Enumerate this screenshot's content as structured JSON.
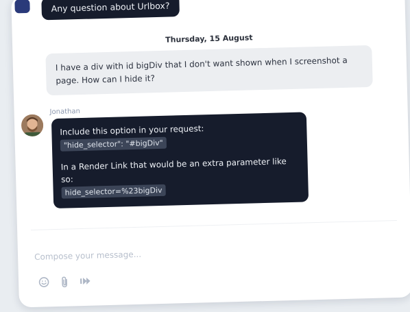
{
  "previous_message": {
    "text": "Any question about Urlbox?"
  },
  "date_separator": "Thursday, 15 August",
  "incoming_message": {
    "text": "I have a div with id bigDiv that I don't want shown when I screenshot a page. How can I hide it?"
  },
  "reply": {
    "sender_name": "Jonathan",
    "line1": "Include this option in your request:",
    "code1": "\"hide_selector\": \"#bigDiv\"",
    "line2": "In a Render Link that would be an extra parameter like so:",
    "code2": "hide_selector=%23bigDiv"
  },
  "composer": {
    "placeholder": "Compose your message..."
  },
  "toolbar": {
    "icons": [
      "emoji-icon",
      "attachment-icon",
      "send-icon"
    ]
  },
  "colors": {
    "dark_bubble": "#161c2c",
    "light_bubble": "#eceef1",
    "code_chip": "#3c4558",
    "placeholder": "#b7bfcc",
    "icon": "#aeb7c6"
  }
}
